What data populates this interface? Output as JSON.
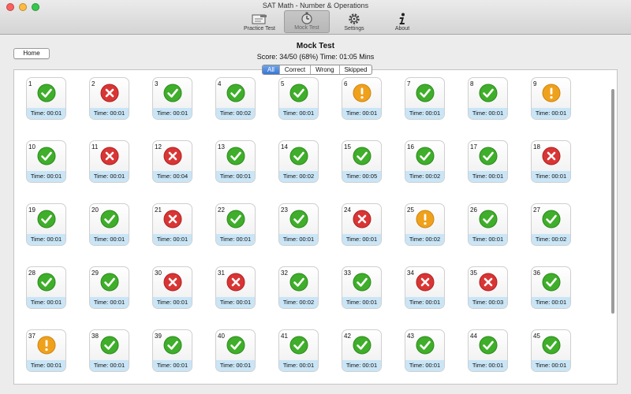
{
  "window": {
    "title": "SAT Math - Number & Operations"
  },
  "toolbar": {
    "items": [
      {
        "label": "Practice Test",
        "icon": "practice-test-icon",
        "selected": false
      },
      {
        "label": "Mock Test",
        "icon": "mock-test-icon",
        "selected": true
      },
      {
        "label": "Settings",
        "icon": "gear-icon",
        "selected": false
      },
      {
        "label": "About",
        "icon": "info-icon",
        "selected": false
      }
    ]
  },
  "home_label": "Home",
  "page_title": "Mock Test",
  "score_text": "Score: 34/50 (68%) Time: 01:05 Mins",
  "filters": [
    {
      "label": "All",
      "active": true
    },
    {
      "label": "Correct",
      "active": false
    },
    {
      "label": "Wrong",
      "active": false
    },
    {
      "label": "Skipped",
      "active": false
    }
  ],
  "colors": {
    "correct": "#3fae2a",
    "wrong": "#d93535",
    "skipped": "#f0a11c",
    "time_band": "#c9e5f6",
    "filter_active": "#3a77d6"
  },
  "questions": [
    {
      "num": "1",
      "status": "correct",
      "time": "Time: 00:01"
    },
    {
      "num": "2",
      "status": "wrong",
      "time": "Time: 00:01"
    },
    {
      "num": "3",
      "status": "correct",
      "time": "Time: 00:01"
    },
    {
      "num": "4",
      "status": "correct",
      "time": "Time: 00:02"
    },
    {
      "num": "5",
      "status": "correct",
      "time": "Time: 00:01"
    },
    {
      "num": "6",
      "status": "skipped",
      "time": "Time: 00:01"
    },
    {
      "num": "7",
      "status": "correct",
      "time": "Time: 00:01"
    },
    {
      "num": "8",
      "status": "correct",
      "time": "Time: 00:01"
    },
    {
      "num": "9",
      "status": "skipped",
      "time": "Time: 00:01"
    },
    {
      "num": "10",
      "status": "correct",
      "time": "Time: 00:01"
    },
    {
      "num": "11",
      "status": "wrong",
      "time": "Time: 00:01"
    },
    {
      "num": "12",
      "status": "wrong",
      "time": "Time: 00:04"
    },
    {
      "num": "13",
      "status": "correct",
      "time": "Time: 00:01"
    },
    {
      "num": "14",
      "status": "correct",
      "time": "Time: 00:02"
    },
    {
      "num": "15",
      "status": "correct",
      "time": "Time: 00:05"
    },
    {
      "num": "16",
      "status": "correct",
      "time": "Time: 00:02"
    },
    {
      "num": "17",
      "status": "correct",
      "time": "Time: 00:01"
    },
    {
      "num": "18",
      "status": "wrong",
      "time": "Time: 00:01"
    },
    {
      "num": "19",
      "status": "correct",
      "time": "Time: 00:01"
    },
    {
      "num": "20",
      "status": "correct",
      "time": "Time: 00:01"
    },
    {
      "num": "21",
      "status": "wrong",
      "time": "Time: 00:01"
    },
    {
      "num": "22",
      "status": "correct",
      "time": "Time: 00:01"
    },
    {
      "num": "23",
      "status": "correct",
      "time": "Time: 00:01"
    },
    {
      "num": "24",
      "status": "wrong",
      "time": "Time: 00:01"
    },
    {
      "num": "25",
      "status": "skipped",
      "time": "Time: 00:02"
    },
    {
      "num": "26",
      "status": "correct",
      "time": "Time: 00:01"
    },
    {
      "num": "27",
      "status": "correct",
      "time": "Time: 00:02"
    },
    {
      "num": "28",
      "status": "correct",
      "time": "Time: 00:01"
    },
    {
      "num": "29",
      "status": "correct",
      "time": "Time: 00:01"
    },
    {
      "num": "30",
      "status": "wrong",
      "time": "Time: 00:01"
    },
    {
      "num": "31",
      "status": "wrong",
      "time": "Time: 00:01"
    },
    {
      "num": "32",
      "status": "correct",
      "time": "Time: 00:02"
    },
    {
      "num": "33",
      "status": "correct",
      "time": "Time: 00:01"
    },
    {
      "num": "34",
      "status": "wrong",
      "time": "Time: 00:01"
    },
    {
      "num": "35",
      "status": "wrong",
      "time": "Time: 00:03"
    },
    {
      "num": "36",
      "status": "correct",
      "time": "Time: 00:01"
    },
    {
      "num": "37",
      "status": "skipped",
      "time": "Time: 00:01"
    },
    {
      "num": "38",
      "status": "correct",
      "time": "Time: 00:01"
    },
    {
      "num": "39",
      "status": "correct",
      "time": "Time: 00:01"
    },
    {
      "num": "40",
      "status": "correct",
      "time": "Time: 00:01"
    },
    {
      "num": "41",
      "status": "correct",
      "time": "Time: 00:01"
    },
    {
      "num": "42",
      "status": "correct",
      "time": "Time: 00:01"
    },
    {
      "num": "43",
      "status": "correct",
      "time": "Time: 00:01"
    },
    {
      "num": "44",
      "status": "correct",
      "time": "Time: 00:01"
    },
    {
      "num": "45",
      "status": "correct",
      "time": "Time: 00:01"
    }
  ]
}
